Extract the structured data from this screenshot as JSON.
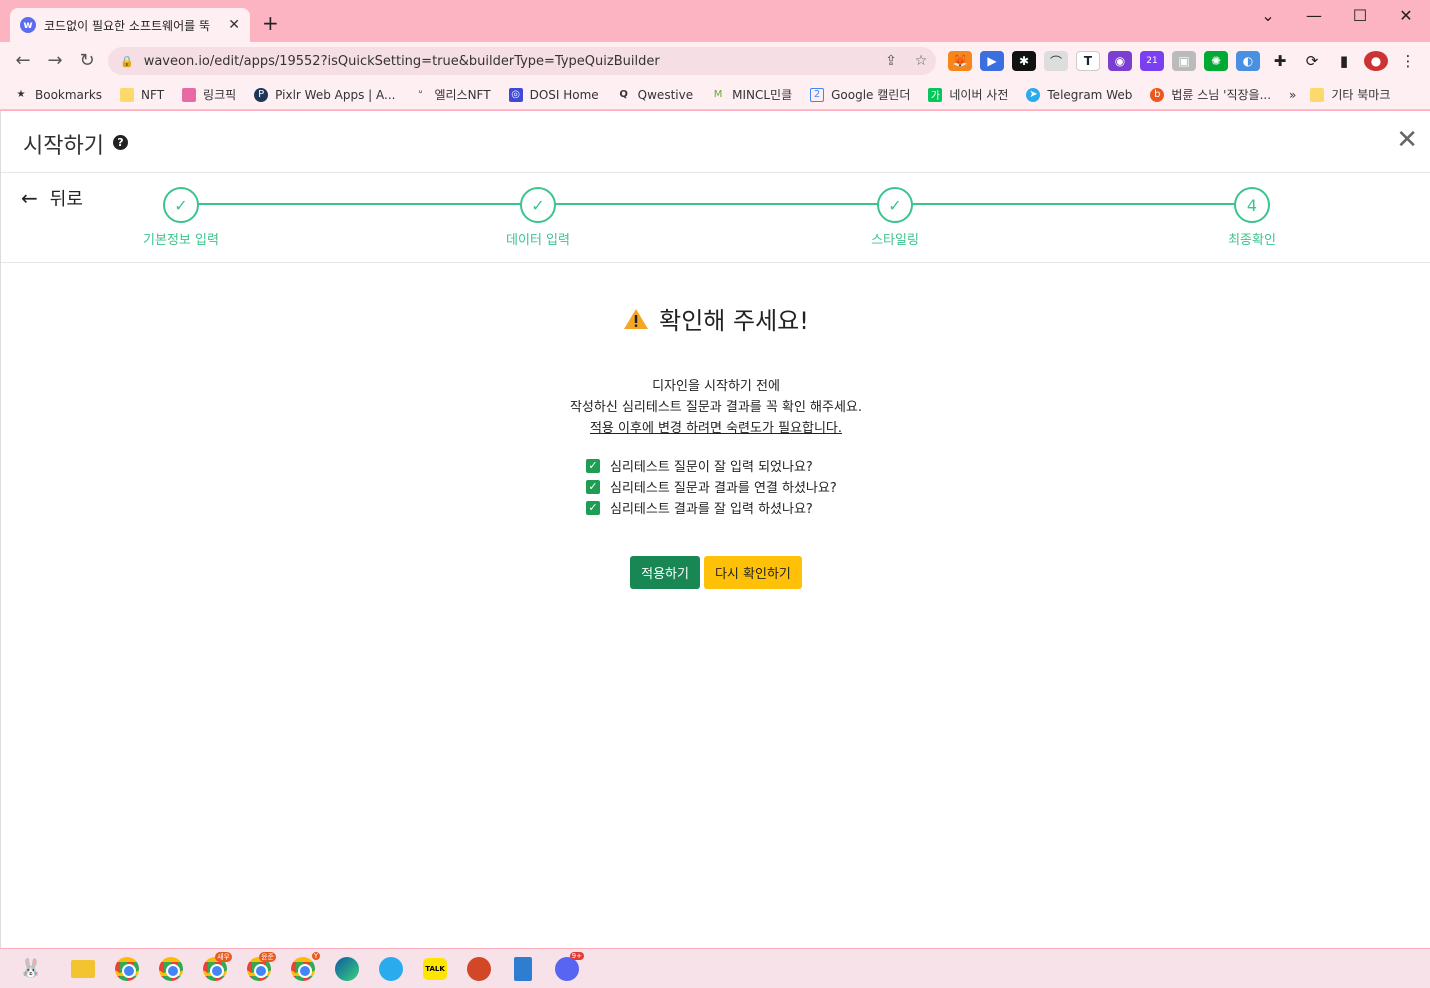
{
  "browser": {
    "tab_title": "코드없이 필요한 소프트웨어를 뚝",
    "favicon_letter": "w",
    "url": "waveon.io/edit/apps/19552?isQuickSetting=true&builderType=TypeQuizBuilder",
    "bookmarks": [
      "Bookmarks",
      "NFT",
      "링크픽",
      "Pixlr Web Apps | A...",
      "엘리스NFT",
      "DOSI Home",
      "Qwestive",
      "MINCL민클",
      "Google 캘린더",
      "네이버 사전",
      "Telegram Web",
      "법륜 스님 '직장을...",
      "기타 북마크"
    ],
    "ext_badge": "21"
  },
  "header": {
    "title": "시작하기",
    "help_icon": "?"
  },
  "stepper": {
    "back_label": "뒤로",
    "steps": [
      {
        "label": "기본정보 입력",
        "mark": "✓"
      },
      {
        "label": "데이터 입력",
        "mark": "✓"
      },
      {
        "label": "스타일링",
        "mark": "✓"
      },
      {
        "label": "최종확인",
        "mark": "4"
      }
    ]
  },
  "confirm": {
    "title": "확인해 주세요!",
    "desc_line1": "디자인을 시작하기 전에",
    "desc_line2": "작성하신 심리테스트 질문과 결과를 꼭 확인 해주세요.",
    "desc_line3": "적용 이후에 변경 하려면 숙련도가 필요합니다.",
    "checks": [
      "심리테스트 질문이 잘 입력 되었나요?",
      "심리테스트 질문과 결과를 연결 하셨나요?",
      "심리테스트 결과를 잘 입력 하셨나요?"
    ],
    "apply_label": "적용하기",
    "recheck_label": "다시 확인하기"
  },
  "taskbar": {
    "badges": [
      "새우",
      "윤준",
      "Y",
      "9+"
    ]
  },
  "colors": {
    "accent_green": "#3cc48e",
    "apply_button": "#198754",
    "recheck_button": "#ffc107",
    "chrome_frame": "#fcb3c2"
  }
}
